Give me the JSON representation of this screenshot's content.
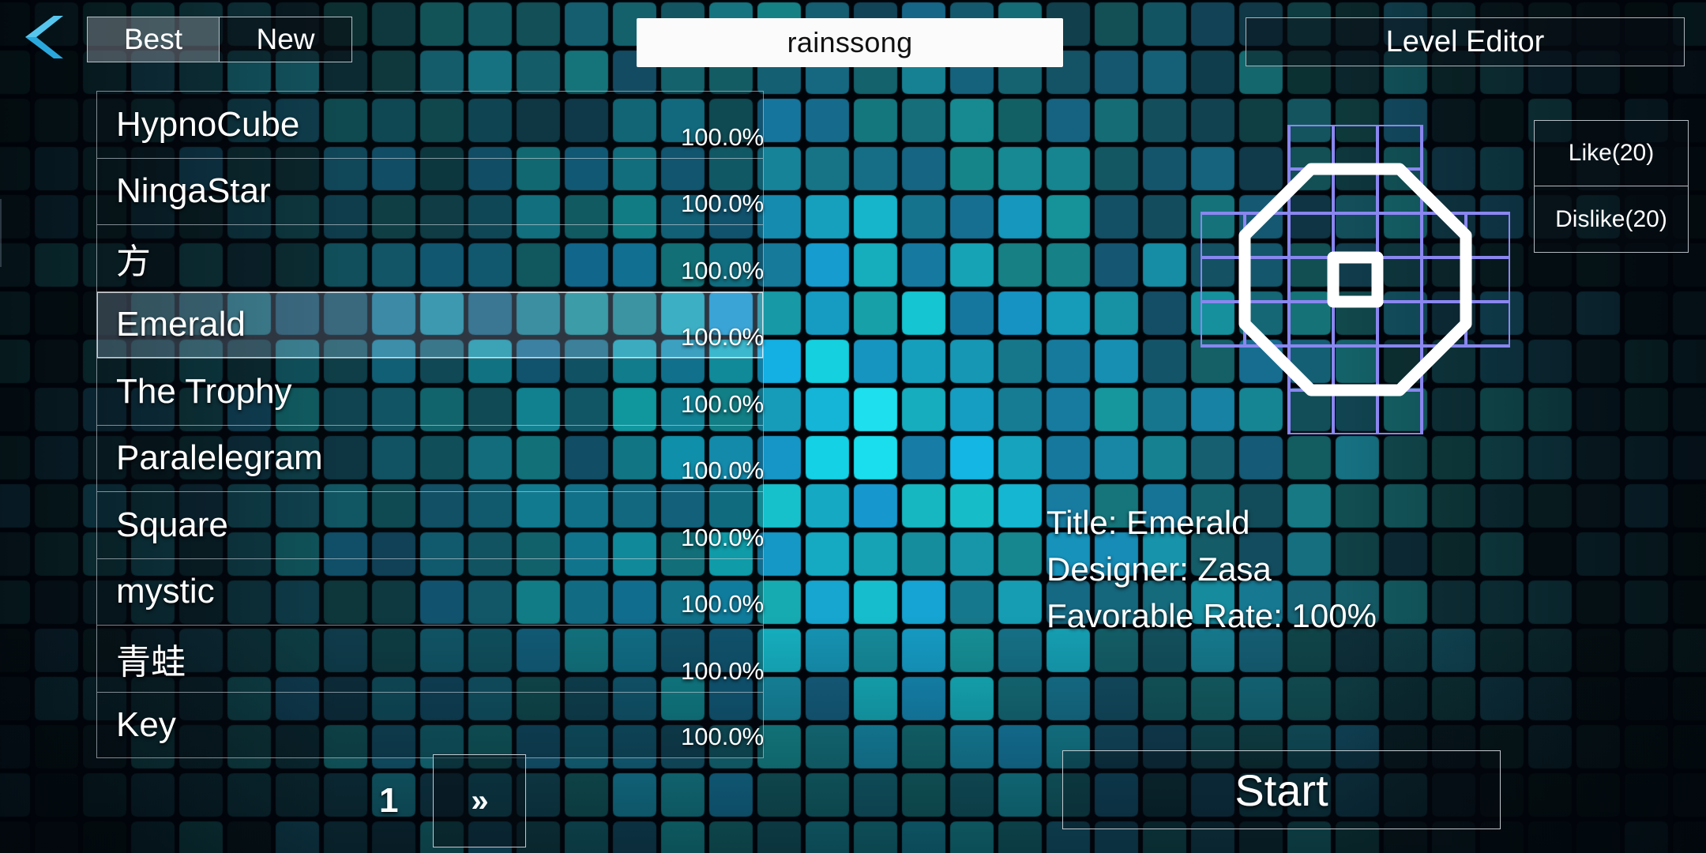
{
  "nav": {
    "back_icon": "back-chevron-icon",
    "tabs": [
      {
        "label": "Best",
        "selected": true
      },
      {
        "label": "New",
        "selected": false
      }
    ],
    "title": "rainssong",
    "level_editor_label": "Level Editor"
  },
  "level_list": {
    "rows": [
      {
        "name": "HypnoCube",
        "rate": "100.0%"
      },
      {
        "name": "NingaStar",
        "rate": "100.0%"
      },
      {
        "name": "方",
        "rate": "100.0%"
      },
      {
        "name": "Emerald",
        "rate": "100.0%"
      },
      {
        "name": "The Trophy",
        "rate": "100.0%"
      },
      {
        "name": "Paralelegram",
        "rate": "100.0%"
      },
      {
        "name": "Square",
        "rate": "100.0%"
      },
      {
        "name": "mystic",
        "rate": "100.0%"
      },
      {
        "name": "青蛙",
        "rate": "100.0%"
      },
      {
        "name": "Key",
        "rate": "100.0%"
      }
    ],
    "selected_index": 3
  },
  "pagination": {
    "current_page": "1",
    "next_label": "»"
  },
  "votes": {
    "like_label": "Like(20)",
    "dislike_label": "Dislike(20)"
  },
  "details": {
    "title_line": "Title: Emerald",
    "designer_line": "Designer: Zasa",
    "rate_line": "Favorable Rate: 100%"
  },
  "actions": {
    "start_label": "Start"
  },
  "colors": {
    "accent_cyan": "#29b6e8",
    "preview_cell_stroke": "#8a86f0",
    "preview_shape_stroke": "#ffffff",
    "panel_border": "#ced4db",
    "title_bg": "#fbfbfb"
  },
  "preview": {
    "shape": "plus-cross-7x7",
    "cell_rows": [
      [
        0,
        0,
        1,
        1,
        1,
        0,
        0
      ],
      [
        0,
        0,
        1,
        1,
        1,
        0,
        0
      ],
      [
        1,
        1,
        1,
        1,
        1,
        1,
        1
      ],
      [
        1,
        1,
        1,
        1,
        1,
        1,
        1
      ],
      [
        1,
        1,
        1,
        1,
        1,
        1,
        1
      ],
      [
        0,
        0,
        1,
        1,
        1,
        0,
        0
      ],
      [
        0,
        0,
        1,
        1,
        1,
        0,
        0
      ]
    ],
    "overlay": "octagon-with-center-square"
  }
}
